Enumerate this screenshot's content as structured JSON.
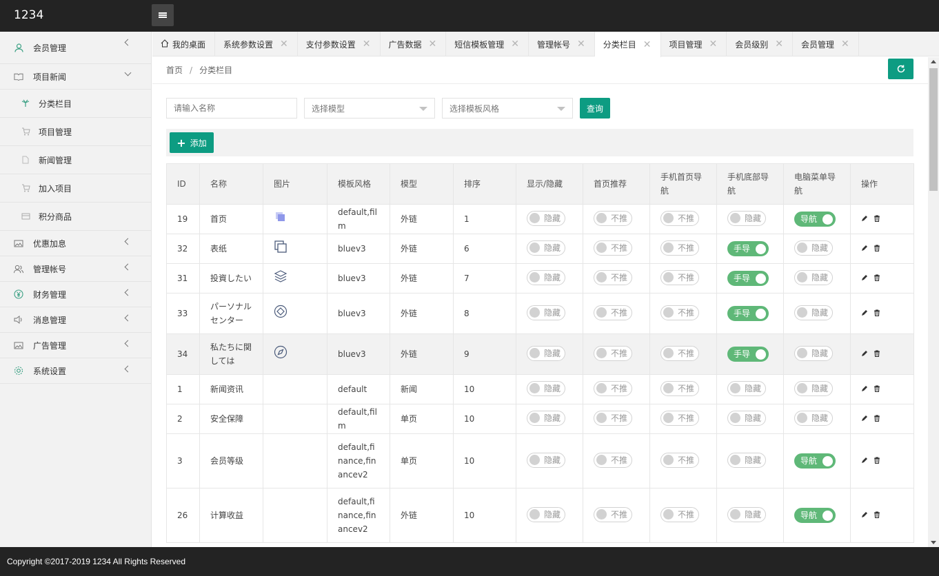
{
  "app": {
    "title": "1234"
  },
  "sidebar": {
    "items": [
      {
        "label": "会员管理",
        "icon": "user-icon",
        "expanded": false
      },
      {
        "label": "项目新闻",
        "icon": "book-icon",
        "expanded": true,
        "children": [
          {
            "label": "分类栏目",
            "icon": "palm-icon",
            "active": true
          },
          {
            "label": "项目管理",
            "icon": "cart-icon"
          },
          {
            "label": "新闻管理",
            "icon": "file-icon"
          },
          {
            "label": "加入项目",
            "icon": "cart-icon"
          },
          {
            "label": "积分商品",
            "icon": "card-icon"
          }
        ]
      },
      {
        "label": "优惠加息",
        "icon": "image-icon",
        "expanded": false
      },
      {
        "label": "管理帐号",
        "icon": "users-icon",
        "expanded": false
      },
      {
        "label": "财务管理",
        "icon": "yen-icon",
        "expanded": false
      },
      {
        "label": "消息管理",
        "icon": "speaker-icon",
        "expanded": false
      },
      {
        "label": "广告管理",
        "icon": "image-icon",
        "expanded": false
      },
      {
        "label": "系统设置",
        "icon": "gear-icon",
        "expanded": false
      }
    ]
  },
  "tabs": [
    {
      "label": "我的桌面",
      "home": true
    },
    {
      "label": "系统参数设置"
    },
    {
      "label": "支付参数设置"
    },
    {
      "label": "广告数据"
    },
    {
      "label": "短信模板管理"
    },
    {
      "label": "管理帐号"
    },
    {
      "label": "分类栏目",
      "active": true
    },
    {
      "label": "项目管理"
    },
    {
      "label": "会员级别"
    },
    {
      "label": "会员管理"
    }
  ],
  "breadcrumb": {
    "home": "首页",
    "sep": "/",
    "current": "分类栏目"
  },
  "filters": {
    "name_placeholder": "请输入名称",
    "model_select": "选择模型",
    "style_select": "选择模板风格",
    "query_label": "查询"
  },
  "toolbar": {
    "add_label": "添加"
  },
  "table": {
    "headers": [
      "ID",
      "名称",
      "图片",
      "模板风格",
      "模型",
      "排序",
      "显示/隐藏",
      "首页推荐",
      "手机首页导航",
      "手机底部导航",
      "电脑菜单导航",
      "操作"
    ],
    "rows": [
      {
        "id": "19",
        "name": "首页",
        "icon": "squares-icon",
        "style": "default,film",
        "model": "外链",
        "sort": "1",
        "show": "隐藏",
        "rec": "不推",
        "mhome": "不推",
        "mbottom": "隐藏",
        "mbottom_on": false,
        "pc": "导航",
        "pc_on": true
      },
      {
        "id": "32",
        "name": "表纸",
        "icon": "copy-icon",
        "style": "bluev3",
        "model": "外链",
        "sort": "6",
        "show": "隐藏",
        "rec": "不推",
        "mhome": "不推",
        "mbottom": "手导",
        "mbottom_on": true,
        "pc": "隐藏",
        "pc_on": false
      },
      {
        "id": "31",
        "name": "投資したい",
        "icon": "layers-icon",
        "style": "bluev3",
        "model": "外链",
        "sort": "7",
        "show": "隐藏",
        "rec": "不推",
        "mhome": "不推",
        "mbottom": "手导",
        "mbottom_on": true,
        "pc": "隐藏",
        "pc_on": false
      },
      {
        "id": "33",
        "name": "パーソナルセンター",
        "icon": "diamond-icon",
        "style": "bluev3",
        "model": "外链",
        "sort": "8",
        "show": "隐藏",
        "rec": "不推",
        "mhome": "不推",
        "mbottom": "手导",
        "mbottom_on": true,
        "pc": "隐藏",
        "pc_on": false
      },
      {
        "id": "34",
        "name": "私たちに関しては",
        "icon": "compass-icon",
        "style": "bluev3",
        "model": "外链",
        "sort": "9",
        "show": "隐藏",
        "rec": "不推",
        "mhome": "不推",
        "mbottom": "手导",
        "mbottom_on": true,
        "pc": "隐藏",
        "pc_on": false
      },
      {
        "id": "1",
        "name": "新闻资讯",
        "icon": "",
        "style": "default",
        "model": "新闻",
        "sort": "10",
        "show": "隐藏",
        "rec": "不推",
        "mhome": "不推",
        "mbottom": "隐藏",
        "mbottom_on": false,
        "pc": "隐藏",
        "pc_on": false
      },
      {
        "id": "2",
        "name": "安全保障",
        "icon": "",
        "style": "default,film",
        "model": "单页",
        "sort": "10",
        "show": "隐藏",
        "rec": "不推",
        "mhome": "不推",
        "mbottom": "隐藏",
        "mbottom_on": false,
        "pc": "隐藏",
        "pc_on": false
      },
      {
        "id": "3",
        "name": "会员等级",
        "icon": "",
        "style": "default,finance,financev2",
        "model": "单页",
        "sort": "10",
        "show": "隐藏",
        "rec": "不推",
        "mhome": "不推",
        "mbottom": "隐藏",
        "mbottom_on": false,
        "pc": "导航",
        "pc_on": true
      },
      {
        "id": "26",
        "name": "计算收益",
        "icon": "",
        "style": "default,finance,financev2",
        "model": "外链",
        "sort": "10",
        "show": "隐藏",
        "rec": "不推",
        "mhome": "不推",
        "mbottom": "隐藏",
        "mbottom_on": false,
        "pc": "导航",
        "pc_on": true
      }
    ]
  },
  "footer": {
    "text": "Copyright ©2017-2019 1234 All Rights Reserved"
  },
  "colors": {
    "accent": "#0d9c82",
    "switch_on": "#5fb878",
    "header_bg": "#232323",
    "sidebar_bg": "#f2f2f2"
  }
}
